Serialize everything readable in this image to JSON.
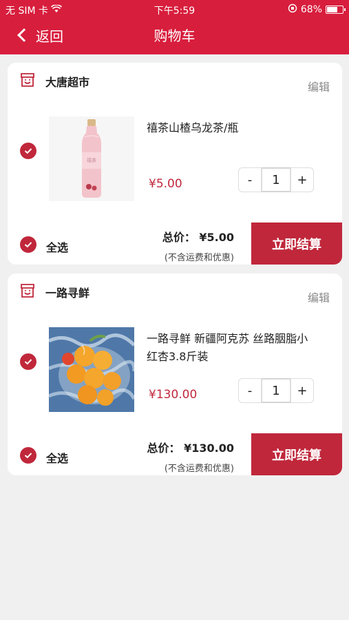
{
  "status_bar": {
    "carrier": "无 SIM 卡",
    "time": "下午5:59",
    "battery": "68%",
    "battery_level": 0.68
  },
  "nav": {
    "back_label": "返回",
    "title": "购物车"
  },
  "colors": {
    "header": "#d81e3d",
    "accent": "#c0273b",
    "background": "#f0f0f0"
  },
  "stores": [
    {
      "name": "大唐超市",
      "edit_label": "编辑",
      "item": {
        "name": "禧茶山楂乌龙茶/瓶",
        "price": "¥5.00",
        "quantity": "1",
        "checked": true,
        "image": "pink-bottle-tea"
      },
      "select_all_label": "全选",
      "total": "总价： ¥5.00",
      "total_note": "(不含运费和优惠)",
      "checkout_label": "立即结算"
    },
    {
      "name": "一路寻鲜",
      "edit_label": "编辑",
      "item": {
        "name": "一路寻鲜 新疆阿克苏 丝路胭脂小红杏3.8斤装",
        "price": "¥130.00",
        "quantity": "1",
        "checked": true,
        "image": "apricots-in-glass-bowl"
      },
      "select_all_label": "全选",
      "total": "总价： ¥130.00",
      "total_note": "(不含运费和优惠)",
      "checkout_label": "立即结算"
    }
  ],
  "qty_minus_label": "-",
  "qty_plus_label": "+"
}
